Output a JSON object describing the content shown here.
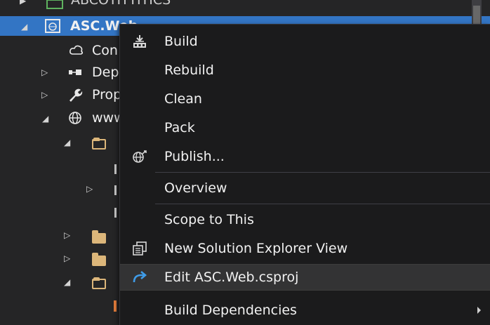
{
  "tree": {
    "top_item_label": "ABCOTITTITICS",
    "project_label": "ASC.Web",
    "connected_services_label": "Con",
    "dependencies_label": "Dep",
    "properties_label": "Prop",
    "wwwroot_label": "www"
  },
  "context_menu": {
    "items": [
      {
        "label": "Build",
        "icon": "build-icon"
      },
      {
        "label": "Rebuild"
      },
      {
        "label": "Clean"
      },
      {
        "label": "Pack"
      },
      {
        "label": "Publish...",
        "icon": "publish-icon"
      },
      {
        "label": "Overview"
      },
      {
        "label": "Scope to This"
      },
      {
        "label": "New Solution Explorer View",
        "icon": "new-explorer-view-icon"
      },
      {
        "label": "Edit ASC.Web.csproj",
        "icon": "edit-project-icon",
        "hovered": true
      },
      {
        "label": "Build Dependencies",
        "has_submenu": true
      }
    ]
  },
  "colors": {
    "selection": "#3375c4",
    "menu_background": "#1b1b1c",
    "menu_hover": "#333334",
    "folder": "#dcb67a",
    "accent_blue": "#3f9ce8"
  }
}
